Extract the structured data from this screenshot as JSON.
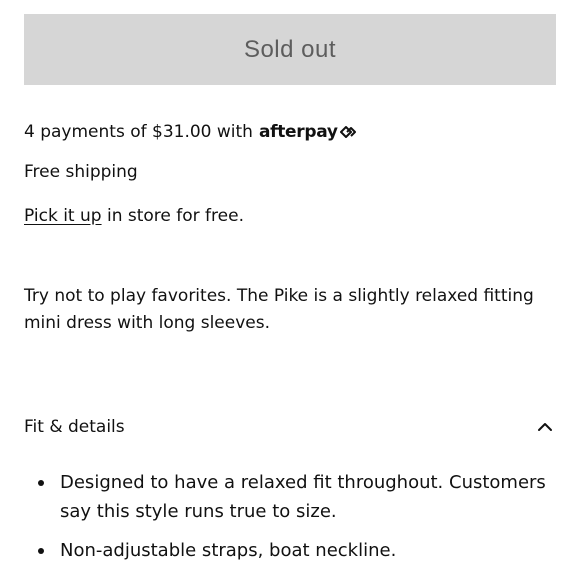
{
  "purchase": {
    "sold_out_label": "Sold out"
  },
  "afterpay": {
    "text": "4 payments of $31.00 with",
    "brand": "afterpay",
    "icon": "afterpay-loop-icon"
  },
  "shipping": {
    "text": "Free shipping"
  },
  "pickup": {
    "link_label": "Pick it up",
    "suffix": " in store for free."
  },
  "description": {
    "text": "Try not to play favorites. The Pike is a slightly relaxed fitting mini dress with long sleeves."
  },
  "fit_details": {
    "title": "Fit & details",
    "expanded": true,
    "toggle_icon": "chevron-up-icon",
    "items": [
      "Designed to have a relaxed fit throughout. Customers say this style runs true to size.",
      "Non-adjustable straps, boat neckline."
    ]
  },
  "colors": {
    "button_bg": "#d6d6d6",
    "button_text": "#5d5d5d",
    "text": "#111111"
  }
}
